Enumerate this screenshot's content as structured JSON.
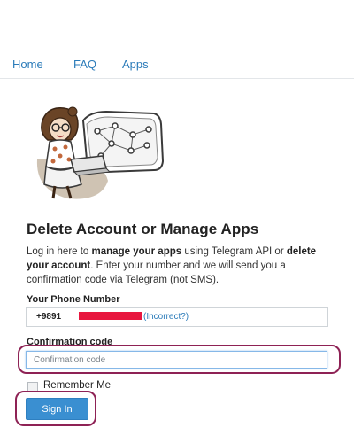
{
  "nav": {
    "items": [
      {
        "label": "Home"
      },
      {
        "label": "FAQ"
      },
      {
        "label": "Apps"
      }
    ]
  },
  "illustration": {
    "icon": "woman-with-laptop-and-network-icon"
  },
  "main": {
    "title": "Delete Account or Manage Apps",
    "intro": {
      "part1": "Log in here to ",
      "bold1": "manage your apps",
      "part2": " using Telegram API or ",
      "bold2": "delete your account",
      "part3": ". Enter your number and we will send you a confirmation code via Telegram (not SMS)."
    }
  },
  "form": {
    "phone_label": "Your Phone Number",
    "phone_prefix": "+9891",
    "incorrect_link": "(Incorrect?)",
    "code_label": "Confirmation code",
    "code_placeholder": "Confirmation code",
    "code_value": "",
    "remember_label": "Remember Me",
    "signin_label": "Sign In"
  },
  "colors": {
    "link": "#2b7bb9",
    "button": "#3a8fd1",
    "redaction": "#e8173f",
    "highlight": "#8e2255"
  }
}
